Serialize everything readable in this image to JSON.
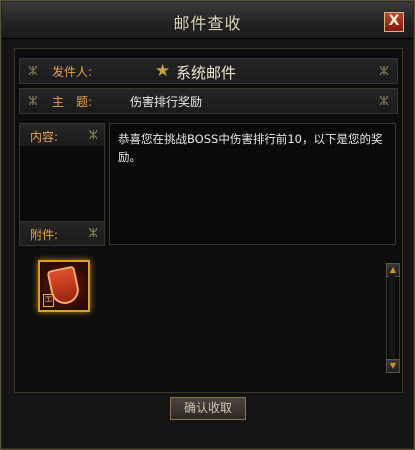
{
  "window": {
    "title": "邮件查收",
    "close_label": "X"
  },
  "sender": {
    "label": "发件人:",
    "name": "系统邮件",
    "icon": "star-icon"
  },
  "subject": {
    "label": "主　题:",
    "value": "伤害排行奖励"
  },
  "content": {
    "label": "内容:",
    "text": "恭喜您在挑战BOSS中伤害排行前10，以下是您的奖励。"
  },
  "attachment": {
    "label": "附件:",
    "item_icon": "shield-item-icon"
  },
  "scrollbar": {
    "up": "▲",
    "down": "▼"
  },
  "actions": {
    "confirm_label": "确认收取"
  },
  "ornament": "ⵣ"
}
